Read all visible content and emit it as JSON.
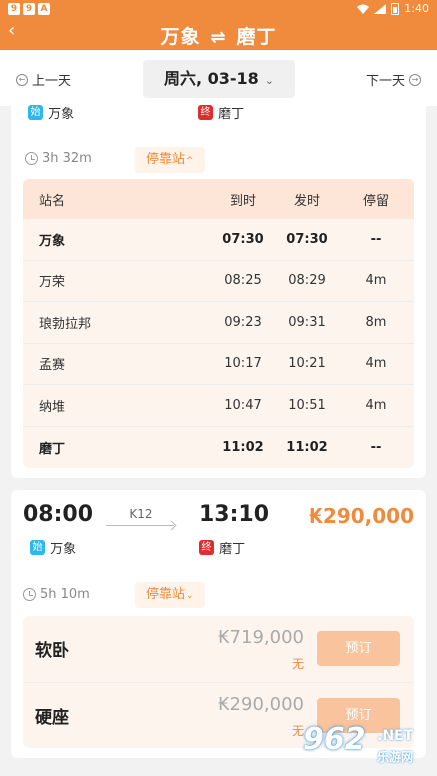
{
  "status_bar": {
    "time": "1:40",
    "icons": [
      "9",
      "9",
      "A"
    ]
  },
  "header": {
    "origin": "万象",
    "swap_symbol": "⇌",
    "destination": "磨丁"
  },
  "date_bar": {
    "prev_label": "上一天",
    "date_label": "周六, 03-18",
    "next_label": "下一天"
  },
  "train1": {
    "origin_badge": "始",
    "origin": "万象",
    "dest_badge": "终",
    "destination": "磨丁",
    "duration": "3h 32m",
    "stops_label": "停靠站",
    "table": {
      "headers": {
        "name": "站名",
        "arrive": "到时",
        "depart": "发时",
        "stay": "停留"
      },
      "rows": [
        {
          "name": "万象",
          "arrive": "07:30",
          "depart": "07:30",
          "stay": "--"
        },
        {
          "name": "万荣",
          "arrive": "08:25",
          "depart": "08:29",
          "stay": "4m"
        },
        {
          "name": "琅勃拉邦",
          "arrive": "09:23",
          "depart": "09:31",
          "stay": "8m"
        },
        {
          "name": "孟赛",
          "arrive": "10:17",
          "depart": "10:21",
          "stay": "4m"
        },
        {
          "name": "纳堆",
          "arrive": "10:47",
          "depart": "10:51",
          "stay": "4m"
        },
        {
          "name": "磨丁",
          "arrive": "11:02",
          "depart": "11:02",
          "stay": "--"
        }
      ]
    }
  },
  "train2": {
    "depart_time": "08:00",
    "train_no": "K12",
    "arrive_time": "13:10",
    "price": "₭290,000",
    "origin_badge": "始",
    "origin": "万象",
    "dest_badge": "终",
    "destination": "磨丁",
    "duration": "5h 10m",
    "stops_label": "停靠站",
    "seats": [
      {
        "name": "软卧",
        "price": "₭719,000",
        "availability": "无",
        "book_label": "预订"
      },
      {
        "name": "硬座",
        "price": "₭290,000",
        "availability": "无",
        "book_label": "预订"
      }
    ]
  },
  "watermark": {
    "number": "962",
    "suffix": ".NET",
    "site": "乐游网"
  },
  "colors": {
    "accent": "#f08a3c",
    "start_badge": "#2db7ee",
    "end_badge": "#e22b2b"
  }
}
